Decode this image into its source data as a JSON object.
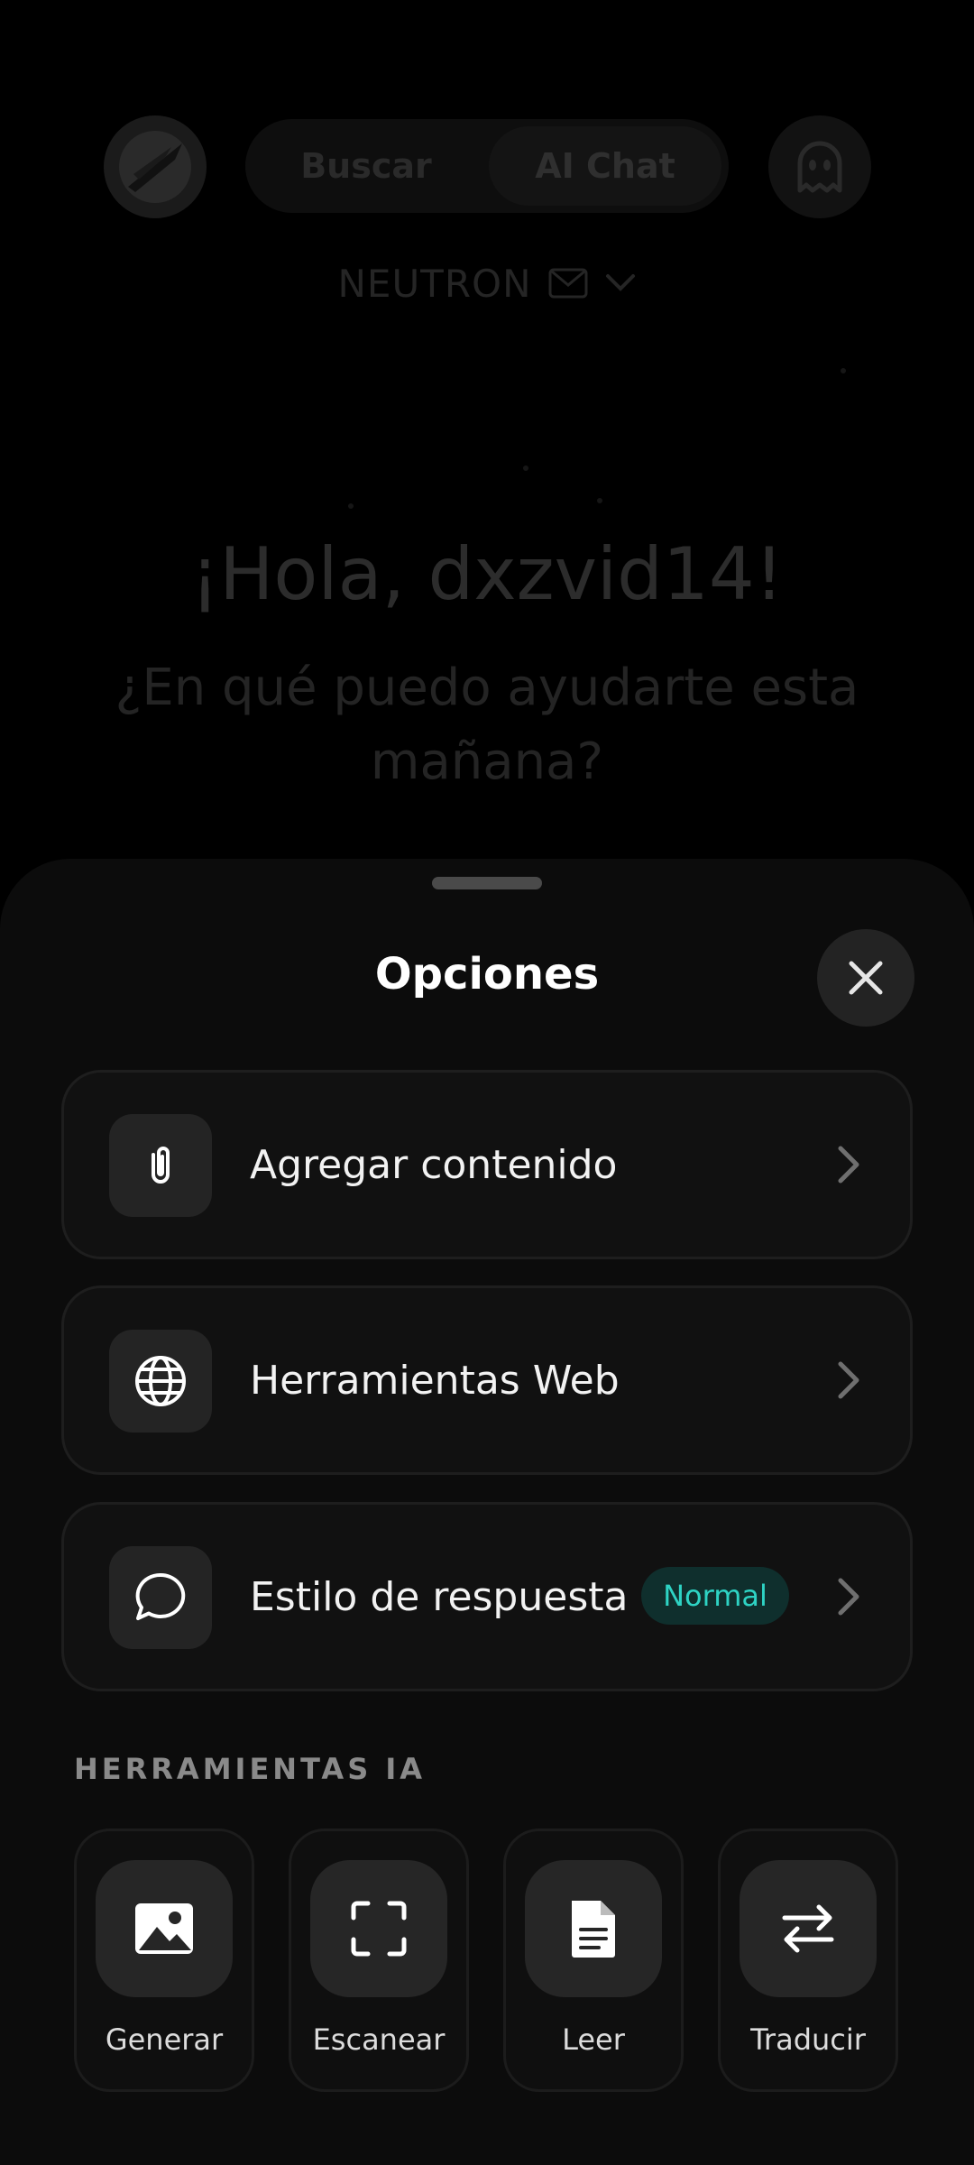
{
  "header": {
    "tabs": [
      {
        "label": "Buscar",
        "selected": false
      },
      {
        "label": "AI Chat",
        "selected": true
      }
    ],
    "workspace_name": "NEUTRON"
  },
  "main": {
    "greeting": "¡Hola, dxzvid14!",
    "question": "¿En qué puedo ayudarte esta mañana?"
  },
  "sheet": {
    "title": "Opciones",
    "options": [
      {
        "label": "Agregar contenido",
        "icon": "paperclip-icon"
      },
      {
        "label": "Herramientas Web",
        "icon": "globe-icon"
      },
      {
        "label": "Estilo de respuesta",
        "icon": "chat-bubble-icon",
        "badge": "Normal"
      }
    ],
    "tools_section_label": "HERRAMIENTAS IA",
    "tools": [
      {
        "label": "Generar",
        "icon": "image-icon"
      },
      {
        "label": "Escanear",
        "icon": "scan-icon"
      },
      {
        "label": "Leer",
        "icon": "document-icon"
      },
      {
        "label": "Traducir",
        "icon": "swap-arrows-icon"
      }
    ]
  },
  "colors": {
    "sheet_background": "#0c0c0c",
    "badge_text": "#2ed3c4",
    "badge_background": "#0f2f2d"
  }
}
